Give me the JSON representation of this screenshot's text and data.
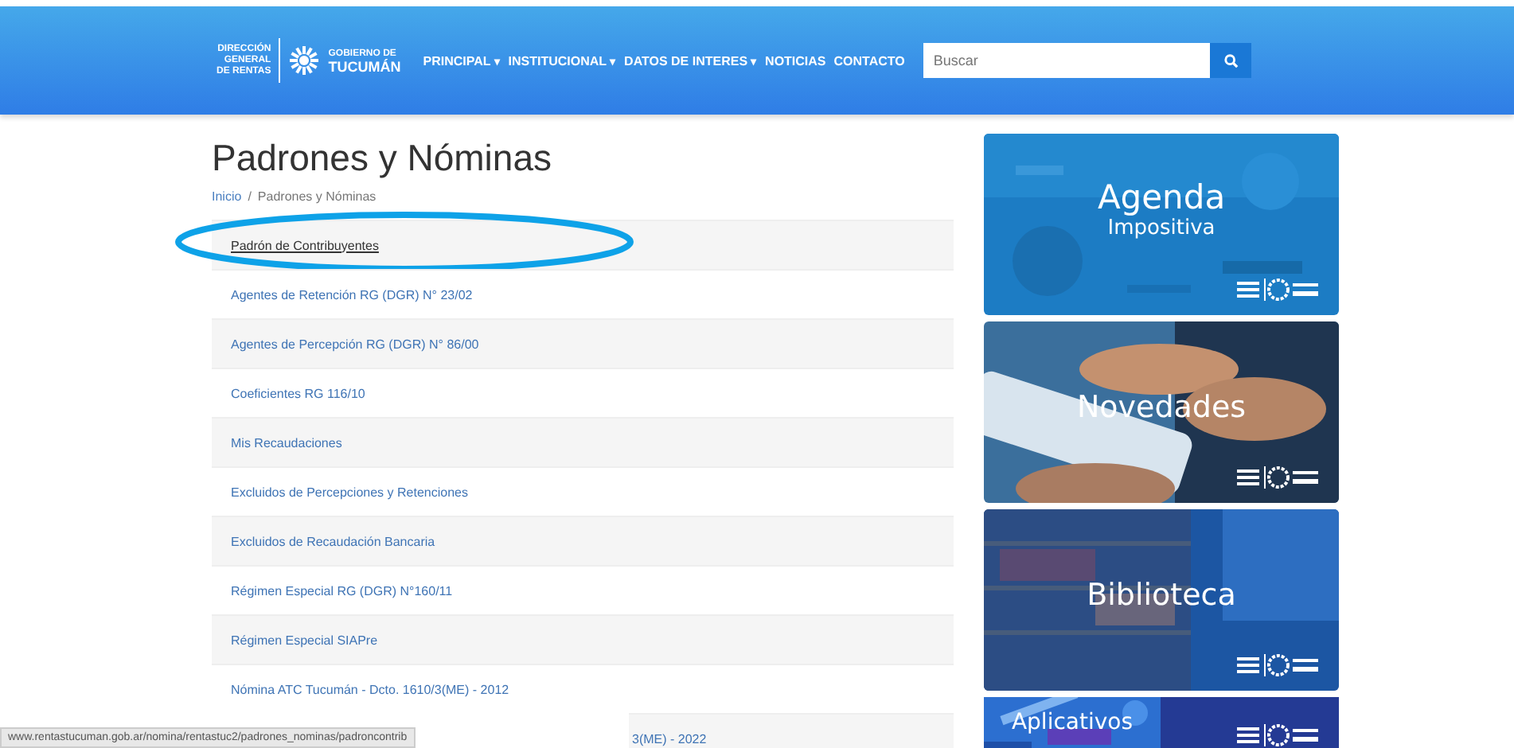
{
  "header": {
    "logo": {
      "left": [
        "DIRECCIÓN",
        "GENERAL",
        "DE RENTAS"
      ],
      "right_top": "GOBIERNO DE",
      "right_bottom": "TUCUMÁN"
    },
    "nav": [
      {
        "label": "PRINCIPAL",
        "dropdown": true,
        "caret": "▾"
      },
      {
        "label": "INSTITUCIONAL",
        "dropdown": true,
        "caret": "▾"
      },
      {
        "label": "DATOS DE INTERES",
        "dropdown": true,
        "caret": "▾"
      },
      {
        "label": "NOTICIAS",
        "dropdown": false
      },
      {
        "label": "CONTACTO",
        "dropdown": false
      }
    ],
    "search": {
      "placeholder": "Buscar"
    }
  },
  "page": {
    "title": "Padrones y Nóminas",
    "breadcrumb": [
      {
        "label": "Inicio",
        "kind": "link"
      },
      {
        "label": "Padrones y Nóminas",
        "kind": "current"
      }
    ],
    "breadcrumb_separator": "/"
  },
  "list": [
    {
      "label": "Padrón de Contribuyentes",
      "hovered": true,
      "circled": true
    },
    {
      "label": "Agentes de Retención RG (DGR) N° 23/02",
      "hovered": false,
      "circled": false
    },
    {
      "label": "Agentes de Percepción RG (DGR) N° 86/00",
      "hovered": false,
      "circled": false
    },
    {
      "label": "Coeficientes RG 116/10",
      "hovered": false,
      "circled": false
    },
    {
      "label": "Mis Recaudaciones",
      "hovered": false,
      "circled": false
    },
    {
      "label": "Excluidos de Percepciones y Retenciones",
      "hovered": false,
      "circled": false
    },
    {
      "label": "Excluidos de Recaudación Bancaria",
      "hovered": false,
      "circled": false
    },
    {
      "label": "Régimen Especial RG (DGR) N°160/11",
      "hovered": false,
      "circled": false
    },
    {
      "label": "Régimen Especial SIAPre",
      "hovered": false,
      "circled": false
    },
    {
      "label": "Nómina ATC Tucumán - Dcto. 1610/3(ME) - 2012",
      "hovered": false,
      "circled": false
    },
    {
      "label": "3(ME) - 2022",
      "hovered": false,
      "circled": false
    }
  ],
  "banners": [
    {
      "title": "Agenda",
      "subtitle": "Impositiva",
      "kind": "calendar"
    },
    {
      "title": "Novedades",
      "kind": "phone"
    },
    {
      "title": "Biblioteca",
      "kind": "library"
    },
    {
      "title": "Aplicativos",
      "kind": "apps"
    }
  ],
  "status_bar": {
    "url": "www.rentastucuman.gob.ar/nomina/rentastuc2/padrones_nominas/padroncontrib"
  }
}
